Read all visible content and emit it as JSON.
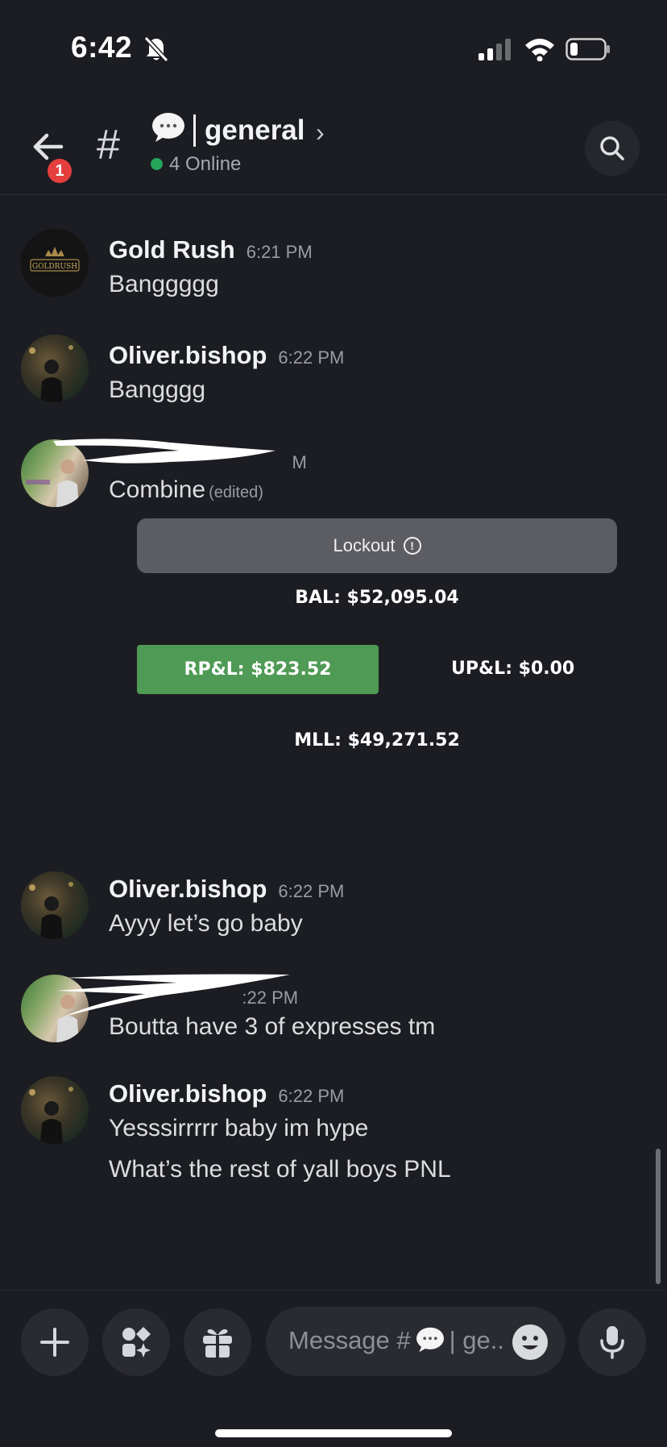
{
  "status_bar": {
    "time": "6:42"
  },
  "header": {
    "badge_count": "1",
    "hash": "#",
    "channel_name": "general",
    "chevron": "›",
    "online_text": "4 Online"
  },
  "messages": [
    {
      "author": "Gold Rush",
      "time": "6:21 PM",
      "text": "Banggggg",
      "avatar_text": "GOLDRUSH"
    },
    {
      "author": "Oliver.bishop",
      "time": "6:22 PM",
      "text": "Bangggg"
    },
    {
      "author_partial": "M",
      "text": "Combine",
      "edited": "(edited)"
    },
    {
      "author": "Oliver.bishop",
      "time": "6:22 PM",
      "text": "Ayyy let’s go baby"
    },
    {
      "author_partial": ":22 PM",
      "text": "Boutta have 3 of expresses tm"
    },
    {
      "author": "Oliver.bishop",
      "time": "6:22 PM",
      "text": "Yesssirrrrr baby im hype",
      "text2": "What’s the rest of yall boys PNL"
    }
  ],
  "embed": {
    "lockout_label": "Lockout",
    "bal": "BAL: $52,095.04",
    "rpl": "RP&L: $823.52",
    "upl": "UP&L: $0.00",
    "mll": "MLL: $49,271.52"
  },
  "composer": {
    "placeholder_prefix": "Message #",
    "placeholder_suffix": "| ge.."
  },
  "colors": {
    "online": "#23a55a",
    "rpl_button": "#4f9a55",
    "badge": "#e53e3e"
  }
}
